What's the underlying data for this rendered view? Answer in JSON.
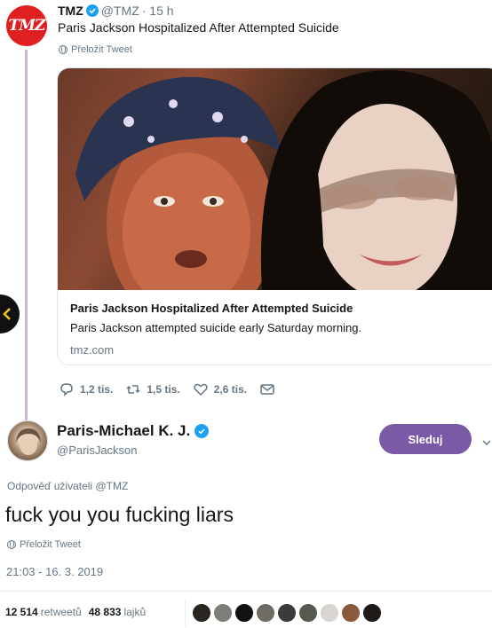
{
  "tmz_tweet": {
    "avatar_text": "TMZ",
    "name": "TMZ",
    "handle": "@TMZ",
    "time": "· 15 h",
    "text": "Paris Jackson Hospitalized After Attempted Suicide",
    "translate_label": "Přeložit Tweet",
    "card": {
      "title": "Paris Jackson Hospitalized After Attempted Suicide",
      "description": "Paris Jackson attempted suicide early Saturday morning.",
      "domain": "tmz.com"
    },
    "actions": {
      "replies": "1,2 tis.",
      "retweets": "1,5 tis.",
      "likes": "2,6 tis."
    }
  },
  "reply_tweet": {
    "name": "Paris-Michael K. J.",
    "handle": "@ParisJackson",
    "follow_label": "Sleduj",
    "reply_prefix": "Odpověď uživateli",
    "reply_handle": "@TMZ",
    "text": "fuck you you fucking liars",
    "translate_label": "Přeložit Tweet",
    "timestamp": "21:03 - 16. 3. 2019",
    "retweet_count": "12 514",
    "retweet_label": "retweetů",
    "like_count": "48 833",
    "like_label": "lajků"
  },
  "colors": {
    "accent": "#7a5aa6",
    "verified": "#1da1f2",
    "muted": "#657786",
    "tmz_red": "#e02020"
  },
  "icons": [
    "verified-badge-icon",
    "globe-icon",
    "reply-icon",
    "retweet-icon",
    "like-icon",
    "message-icon",
    "chevron-down-icon",
    "arrow-left-icon"
  ]
}
